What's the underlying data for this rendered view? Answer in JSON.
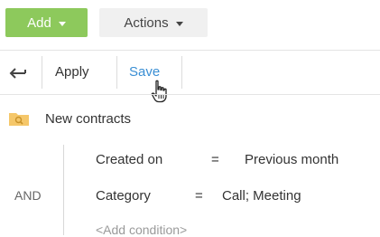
{
  "toolbar": {
    "add_label": "Add",
    "actions_label": "Actions",
    "add_color": "#8dc95c"
  },
  "filter_bar": {
    "apply_label": "Apply",
    "save_label": "Save",
    "back_icon": "back-arrow-icon",
    "link_color": "#3b8fd4"
  },
  "folder": {
    "name": "New contracts",
    "icon": "search-folder-icon",
    "icon_color": "#f5c76a"
  },
  "conditions": {
    "group_operator": "AND",
    "items": [
      {
        "field": "Created on",
        "operator": "=",
        "value": "Previous month"
      },
      {
        "field": "Category",
        "operator": "=",
        "value": "Call; Meeting"
      }
    ],
    "add_label": "<Add condition>"
  }
}
